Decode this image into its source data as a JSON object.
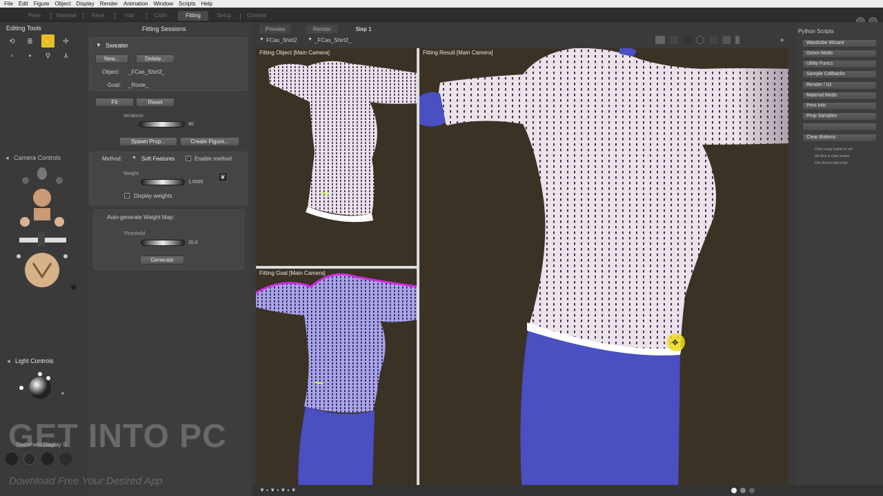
{
  "menu": [
    "File",
    "Edit",
    "Figure",
    "Object",
    "Display",
    "Render",
    "Animation",
    "Window",
    "Scripts",
    "Help"
  ],
  "rooms": [
    "Pose",
    "Material",
    "Face",
    "Hair",
    "Cloth",
    "Fitting",
    "Setup",
    "Content"
  ],
  "active_room": "Fitting",
  "left": {
    "editing_tools_title": "Editing Tools",
    "camera_controls_title": "Camera Controls",
    "light_controls_title": "Light Controls",
    "document_display_title": "Document Display S"
  },
  "fitting": {
    "title": "Fitting Sessions",
    "session_name": "Sweater",
    "new_label": "New...",
    "delete_label": "Delete...",
    "object_label": "Object:",
    "object_value": "_FCas_Shirt2_",
    "goal_label": "Goal:",
    "goal_value": "_Roxie_",
    "fit_label": "Fit",
    "reset_label": "Reset",
    "iterations_label": "Iterations",
    "iterations_value": "40",
    "spawn_prop_label": "Spawn Prop...",
    "create_figure_label": "Create Figure...",
    "method_label": "Method:",
    "method_value": "Soft Features",
    "enable_method_label": "Enable method",
    "weight_label": "Weight",
    "weight_value": "1.0000",
    "display_weights_label": "Display weights",
    "autogen_label": "Auto-generate Weight Map:",
    "threshold_label": "Threshold",
    "threshold_value": "20.0",
    "generate_label": "Generate"
  },
  "view": {
    "tabs": [
      "Preview",
      "Render",
      "Step 1"
    ],
    "active_tab": "Step 1",
    "selector_object": "FCas_Shirt2",
    "selector_part": "_FCas_Shirt2_",
    "viewport_object": "Fitting Object [Main Camera]",
    "viewport_goal": "Fitting Goal [Main Camera]",
    "viewport_result": "Fitting Result [Main Camera]"
  },
  "python": {
    "title": "Python Scripts",
    "buttons": [
      "Wardrobe Wizard",
      "Geom Mods",
      "Utility Funcs",
      "Sample Callbacks",
      "Render / IO",
      "Material Mods",
      "Print Info",
      "Prop Samples",
      "",
      "Clear Buttons"
    ],
    "help": [
      "Click empty button to set",
      "Alt-click to clear button",
      "Ctrl-click to edit script"
    ]
  },
  "watermark": {
    "main": "GET INTO PC",
    "sub": "Download Free Your Desired App"
  },
  "colors": {
    "accent_yellow": "#e3c12a",
    "viewport_bg": "#3b3226",
    "shirt": "#e8e0e6",
    "body_blue": "#4a4fc2"
  }
}
